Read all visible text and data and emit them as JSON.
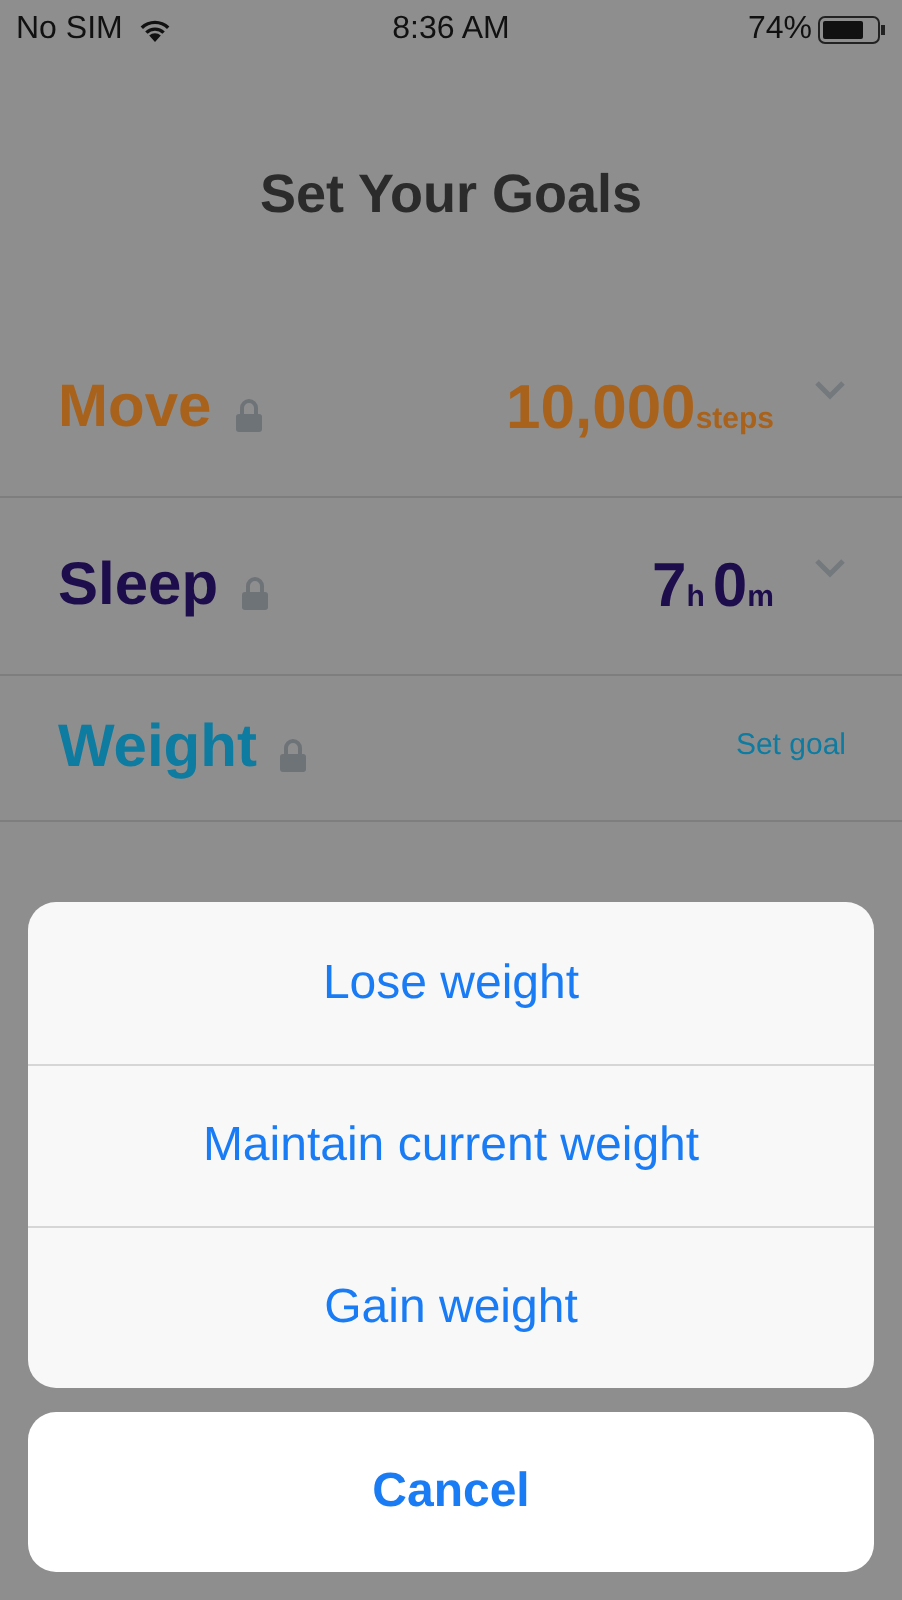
{
  "status_bar": {
    "carrier": "No SIM",
    "time": "8:36 AM",
    "battery": "74%"
  },
  "title": "Set Your Goals",
  "goals": [
    {
      "name": "Move",
      "color": "#a9621c",
      "kind": "value",
      "value": [
        {
          "text": "10,000",
          "kind": "number"
        },
        {
          "text": "steps",
          "kind": "unit"
        }
      ]
    },
    {
      "name": "Sleep",
      "color": "#1e0d4c",
      "kind": "value",
      "value": [
        {
          "text": "7",
          "kind": "number"
        },
        {
          "text": "h",
          "kind": "unit"
        },
        {
          "text": "0",
          "kind": "number"
        },
        {
          "text": "m",
          "kind": "unit"
        }
      ]
    },
    {
      "name": "Weight",
      "color": "#0e7ba0",
      "kind": "link",
      "link": "Set goal"
    }
  ],
  "action_sheet": {
    "options": [
      "Lose weight",
      "Maintain current weight",
      "Gain weight"
    ],
    "cancel": "Cancel"
  }
}
